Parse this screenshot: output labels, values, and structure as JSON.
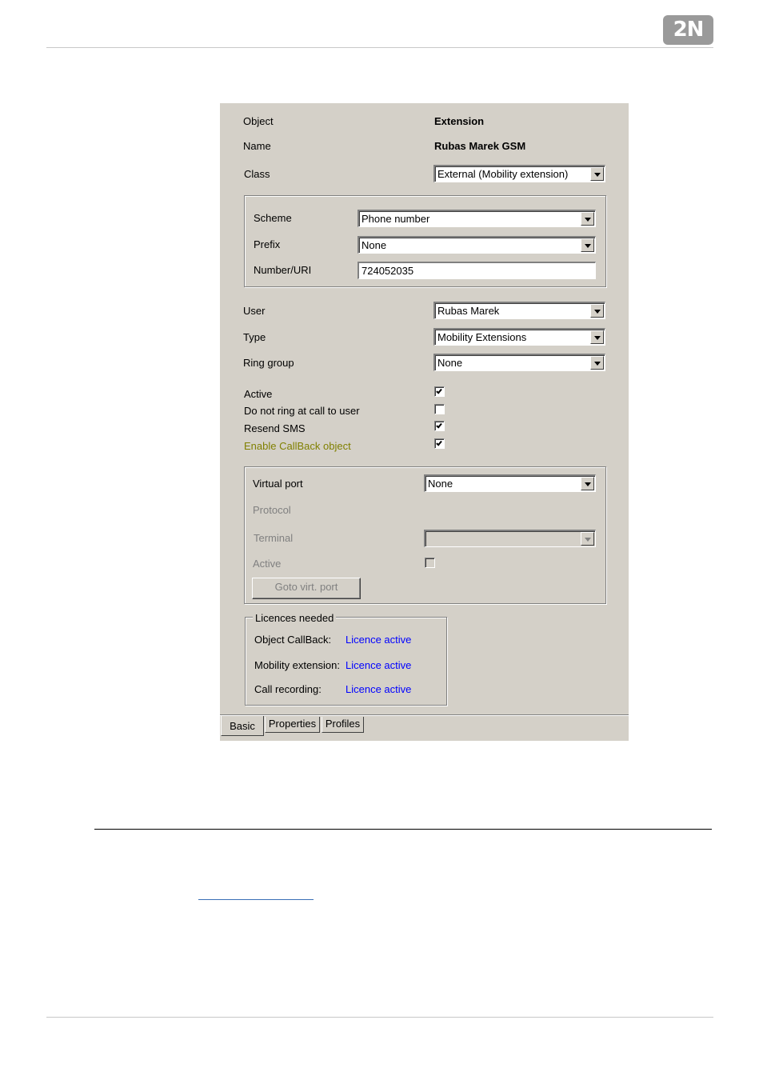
{
  "header": {
    "logo_text": "2N"
  },
  "form": {
    "object_label": "Object",
    "object_value": "Extension",
    "name_label": "Name",
    "name_value": "Rubas Marek GSM",
    "class_label": "Class",
    "class_value": "External (Mobility extension)",
    "scheme_label": "Scheme",
    "scheme_value": "Phone number",
    "prefix_label": "Prefix",
    "prefix_value": "None",
    "number_label": "Number/URI",
    "number_value": "724052035",
    "user_label": "User",
    "user_value": "Rubas Marek",
    "type_label": "Type",
    "type_value": "Mobility Extensions",
    "ring_group_label": "Ring group",
    "ring_group_value": "None",
    "checkboxes": [
      {
        "label": "Active",
        "checked": true
      },
      {
        "label": "Do not ring at call to user",
        "checked": false
      },
      {
        "label": "Resend SMS",
        "checked": true
      },
      {
        "label": "Enable CallBack object",
        "checked": true
      }
    ],
    "virtual_port_label": "Virtual port",
    "virtual_port_value": "None",
    "protocol_label": "Protocol",
    "terminal_label": "Terminal",
    "terminal_value": "",
    "vp_active_label": "Active",
    "goto_button": "Goto virt. port",
    "licences": {
      "legend": "Licences needed",
      "rows": [
        {
          "name": "Object CallBack:",
          "status": "Licence active"
        },
        {
          "name": "Mobility extension:",
          "status": "Licence active"
        },
        {
          "name": "Call recording:",
          "status": "Licence active"
        }
      ]
    },
    "tabs": [
      "Basic",
      "Properties",
      "Profiles"
    ],
    "active_tab": "Basic"
  },
  "colors": {
    "panel_bg": "#d4d0c8",
    "link": "#0000ff",
    "highlight_label": "#808000",
    "disabled_text": "#808080"
  }
}
